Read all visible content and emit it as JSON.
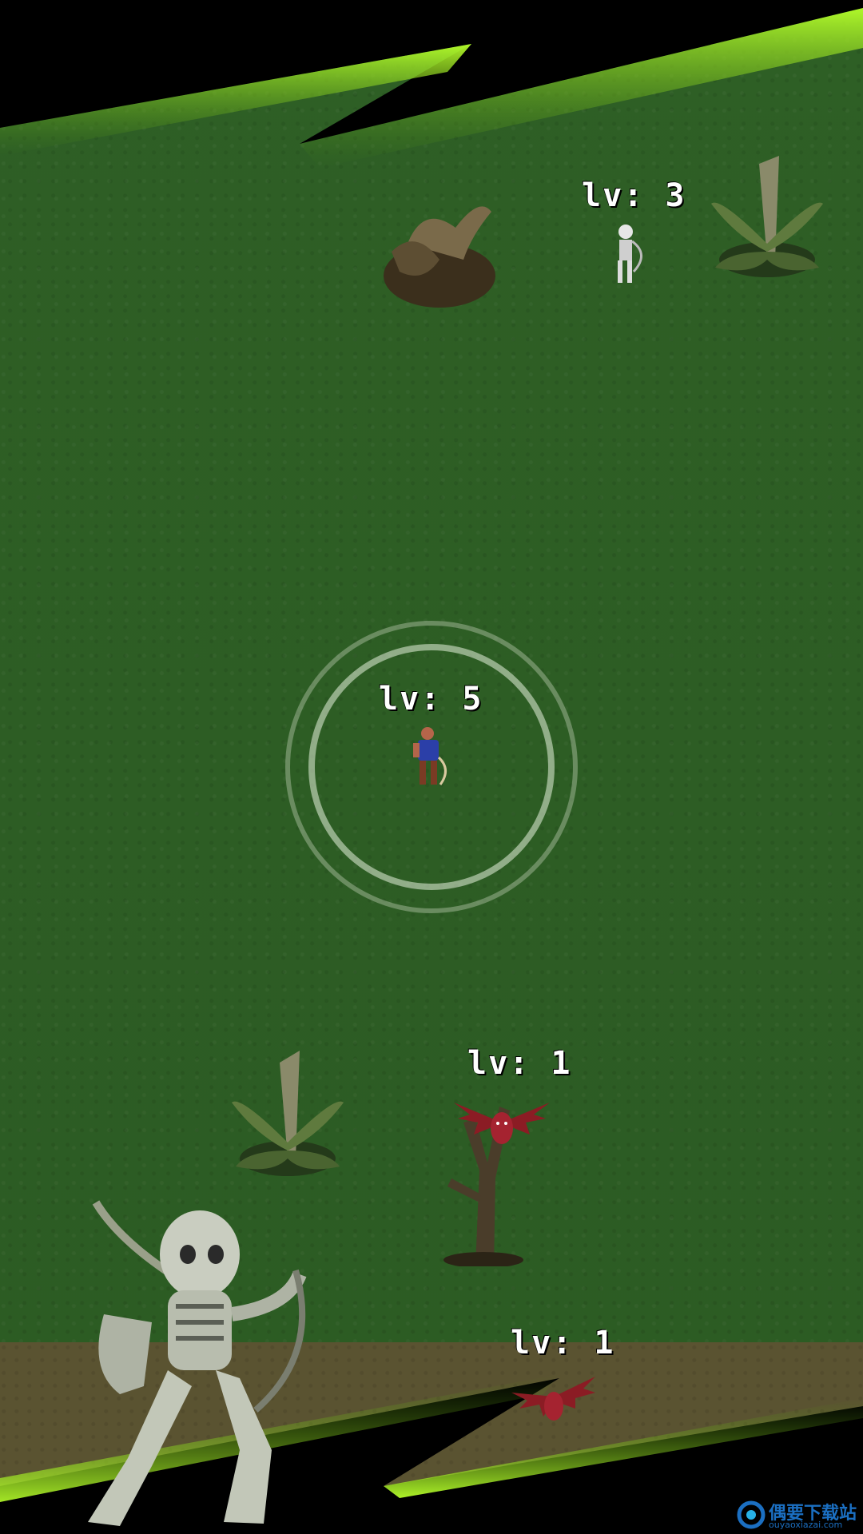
{
  "enemies": [
    {
      "kind": "skeleton",
      "level_text": "lv: 3"
    },
    {
      "kind": "bat",
      "level_text": "lv: 1"
    },
    {
      "kind": "bat",
      "level_text": "lv: 1"
    }
  ],
  "player": {
    "level_text": "lv: 5"
  },
  "watermark": {
    "title": "偶要下载站",
    "subtitle": "ouyaoxiazai.com"
  },
  "colors": {
    "grass": "#2c5b23",
    "accent_green": "#7fe01a",
    "path": "#5a5331"
  }
}
